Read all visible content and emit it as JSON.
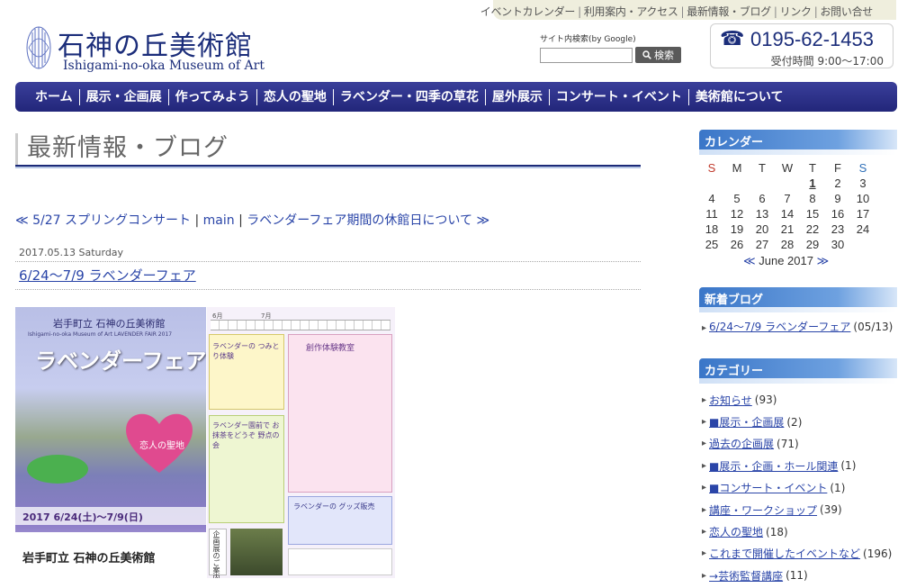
{
  "top_links": [
    "イベントカレンダー",
    "利用案内・アクセス",
    "最新情報・ブログ",
    "リンク",
    "お問い合せ"
  ],
  "logo": {
    "title_jp": "石神の丘美術館",
    "title_en": "Ishigami-no-oka Museum of Art"
  },
  "search": {
    "label": "サイト内検索(by Google)",
    "button": "検索",
    "value": ""
  },
  "contact": {
    "phone": "0195-62-1453",
    "hours": "受付時間 9:00〜17:00"
  },
  "nav": [
    "ホーム",
    "展示・企画展",
    "作ってみよう",
    "恋人の聖地",
    "ラベンダー・四季の草花",
    "屋外展示",
    "コンサート・イベント",
    "美術館について"
  ],
  "page_title": "最新情報・ブログ",
  "entry_nav": {
    "prev": "5/27 スプリングコンサート",
    "main": "main",
    "next": "ラベンダーフェア期間の休館日について"
  },
  "post": {
    "date": "2017.05.13 Saturday",
    "title": "6/24〜7/9 ラベンダーフェア"
  },
  "flyer": {
    "town": "岩手町立 石神の丘美術館",
    "subtitle": "Ishigami-no-oka Museum of Art LAVENDER FAIR 2017",
    "headline": "ラベンダーフェア",
    "heart": "恋人の聖地",
    "dates": "2017 6/24(土)〜7/9(日)",
    "footer": "岩手町立 石神の丘美術館",
    "box1": "ラベンダーの つみとり体験",
    "box2": "創作体験教室",
    "box3": "ラベンダー園前で お抹茶をどうぞ 野点の会",
    "box4": "ラベンダーの グッズ販売",
    "months": [
      "6月",
      "7月"
    ],
    "side_label": "企画展のご案内"
  },
  "sidebar": {
    "calendar_title": "カレンダー",
    "weekdays": [
      "S",
      "M",
      "T",
      "W",
      "T",
      "F",
      "S"
    ],
    "weeks": [
      [
        "",
        "",
        "",
        "",
        "1",
        "2",
        "3"
      ],
      [
        "4",
        "5",
        "6",
        "7",
        "8",
        "9",
        "10"
      ],
      [
        "11",
        "12",
        "13",
        "14",
        "15",
        "16",
        "17"
      ],
      [
        "18",
        "19",
        "20",
        "21",
        "22",
        "23",
        "24"
      ],
      [
        "25",
        "26",
        "27",
        "28",
        "29",
        "30",
        ""
      ]
    ],
    "month_label": "June 2017",
    "recent_title": "新着ブログ",
    "recent_items": [
      {
        "title": "6/24〜7/9 ラベンダーフェア",
        "date": "(05/13)"
      }
    ],
    "category_title": "カテゴリー",
    "categories": [
      {
        "name": "お知らせ",
        "count": "(93)"
      },
      {
        "name": "■展示・企画展",
        "count": "(2)"
      },
      {
        "name": "過去の企画展",
        "count": "(71)"
      },
      {
        "name": "■展示・企画・ホール関連",
        "count": "(1)"
      },
      {
        "name": "■コンサート・イベント",
        "count": "(1)"
      },
      {
        "name": "講座・ワークショップ",
        "count": "(39)"
      },
      {
        "name": "恋人の聖地",
        "count": "(18)"
      },
      {
        "name": "これまで開催したイベントなど",
        "count": "(196)"
      },
      {
        "name": "→芸術監督講座",
        "count": "(11)"
      }
    ]
  },
  "colors": {
    "brand_navy": "#1b2d7a",
    "nav_bg": "#2a2f88",
    "link": "#2a45a8",
    "sidebar_head": "#3a76c8",
    "sunday": "#c0392b",
    "saturday": "#2e6fb8"
  }
}
